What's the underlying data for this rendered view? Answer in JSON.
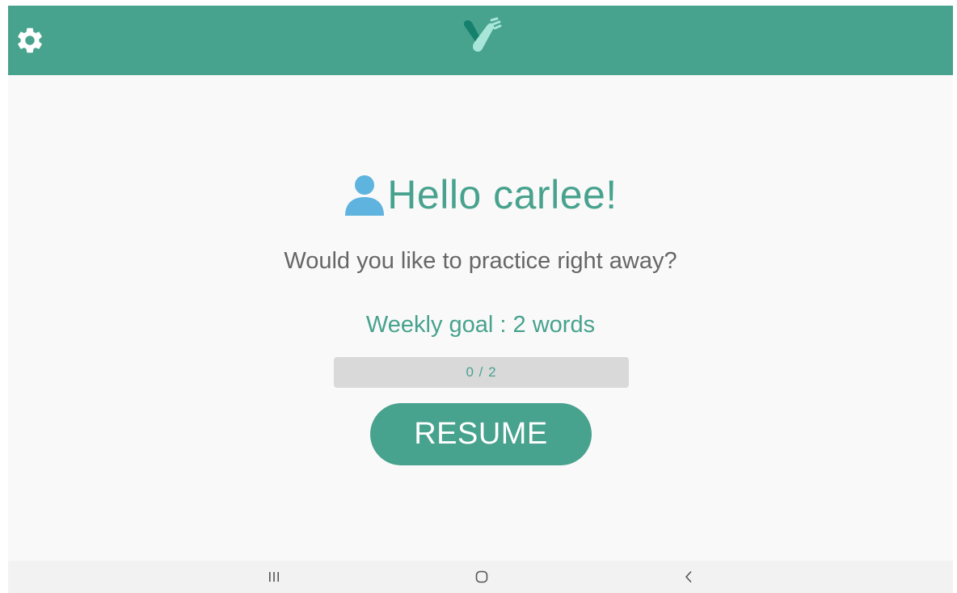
{
  "colors": {
    "accent": "#47a28e",
    "profile_icon": "#5fb3df",
    "subtitle_text": "#666666",
    "progress_track": "#d9d9d9",
    "background": "#f9f9f9"
  },
  "header": {
    "settings_icon": "gear-icon",
    "logo_icon": "app-logo-icon"
  },
  "main": {
    "profile_icon": "user-icon",
    "greeting": "Hello carlee!",
    "prompt": "Would you like to practice right away?",
    "weekly_goal_label": "Weekly goal : 2 words",
    "progress": {
      "current": 0,
      "total": 2,
      "text": "0 / 2"
    },
    "resume_label": "RESUME"
  },
  "navigation": {
    "recents_icon": "recent-apps-icon",
    "home_icon": "home-icon",
    "back_icon": "back-icon"
  }
}
